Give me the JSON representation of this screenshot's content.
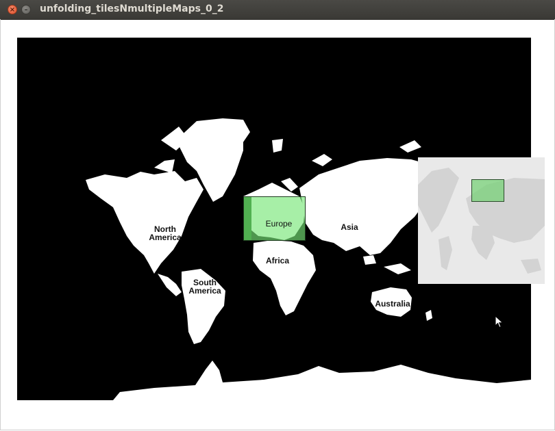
{
  "window": {
    "title": "unfolding_tilesNmultipleMaps_0_2",
    "close_glyph": "×",
    "minimize_glyph": "–"
  },
  "map": {
    "labels": {
      "north_america": "North America",
      "south_america": "South America",
      "europe": "Europe",
      "africa": "Africa",
      "asia": "Asia",
      "australia": "Australia"
    },
    "land_color": "#ffffff",
    "ocean_color": "#000000"
  },
  "focus_highlight": {
    "color": "#78e678"
  },
  "overview_map": {
    "background": "#e9e9e9",
    "land_color": "#d3d3d3",
    "highlight_color": "#78d278"
  },
  "icons": {
    "cursor": "arrow-pointer-icon"
  }
}
